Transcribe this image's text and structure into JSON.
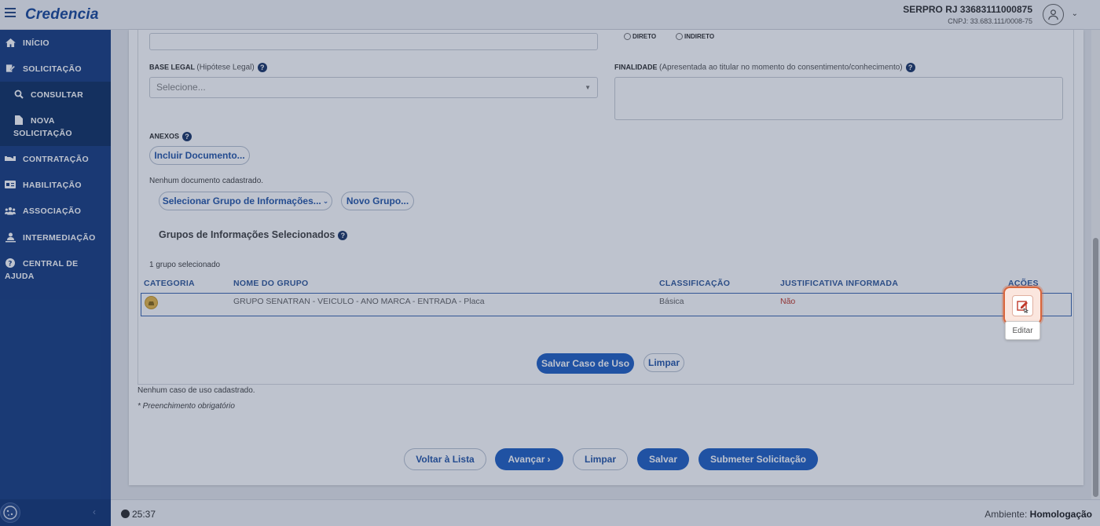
{
  "app": {
    "logo": "Credencia"
  },
  "user": {
    "name": "SERPRO RJ 33683111000875",
    "cnpj": "CNPJ: 33.683.111/0008-75"
  },
  "sidebar": {
    "items": [
      {
        "label": "INÍCIO",
        "icon": "home-icon"
      },
      {
        "label": "SOLICITAÇÃO",
        "icon": "edit-document-icon"
      },
      {
        "label": "CONSULTAR",
        "icon": "search-icon"
      },
      {
        "label_line1": "NOVA",
        "label_line2": "SOLICITAÇÃO",
        "icon": "file-icon"
      },
      {
        "label": "CONTRATAÇÃO",
        "icon": "handshake-icon"
      },
      {
        "label": "HABILITAÇÃO",
        "icon": "id-card-icon"
      },
      {
        "label": "ASSOCIAÇÃO",
        "icon": "users-icon"
      },
      {
        "label": "INTERMEDIAÇÃO",
        "icon": "user-network-icon"
      },
      {
        "label_line1": "CENTRAL DE",
        "label_line2": "AJUDA",
        "icon": "help-icon"
      }
    ]
  },
  "form": {
    "radio_direto": "DIRETO",
    "radio_indireto": "INDIRETO",
    "base_legal_label": "BASE LEGAL",
    "base_legal_sub": "(Hipótese Legal)",
    "base_legal_placeholder": "Selecione...",
    "finalidade_label": "FINALIDADE",
    "finalidade_sub": "(Apresentada ao titular no momento do consentimento/conhecimento)",
    "anexos_label": "ANEXOS",
    "incluir_documento": "Incluir Documento...",
    "nenhum_documento": "Nenhum documento cadastrado.",
    "selecionar_grupo": "Selecionar Grupo de Informações...",
    "novo_grupo": "Novo Grupo...",
    "grupos_title": "Grupos de Informações Selecionados",
    "grupo_count": "1 grupo selecionado",
    "salvar_caso": "Salvar Caso de Uso",
    "limpar_caso": "Limpar",
    "nenhum_caso": "Nenhum caso de uso cadastrado.",
    "obrigatorio": "* Preenchimento obrigatório"
  },
  "table": {
    "headers": [
      "CATEGORIA",
      "NOME DO GRUPO",
      "CLASSIFICAÇÃO",
      "JUSTIFICATIVA INFORMADA",
      "AÇÕES"
    ],
    "rows": [
      {
        "nome": "GRUPO SENATRAN - VEICULO - ANO MARCA - ENTRADA - Placa",
        "classificacao": "Básica",
        "justificativa": "Não"
      }
    ],
    "tooltip": "Editar"
  },
  "actions": {
    "voltar": "Voltar à Lista",
    "avancar": "Avançar",
    "limpar": "Limpar",
    "salvar": "Salvar",
    "submeter": "Submeter Solicitação"
  },
  "footer": {
    "timer": "25:37",
    "ambiente_label": "Ambiente:",
    "ambiente_value": "Homologação"
  },
  "colors": {
    "sidebar": "#1c4183",
    "primary": "#2563c4",
    "highlight": "#d9653b",
    "negative": "#c0392b"
  }
}
